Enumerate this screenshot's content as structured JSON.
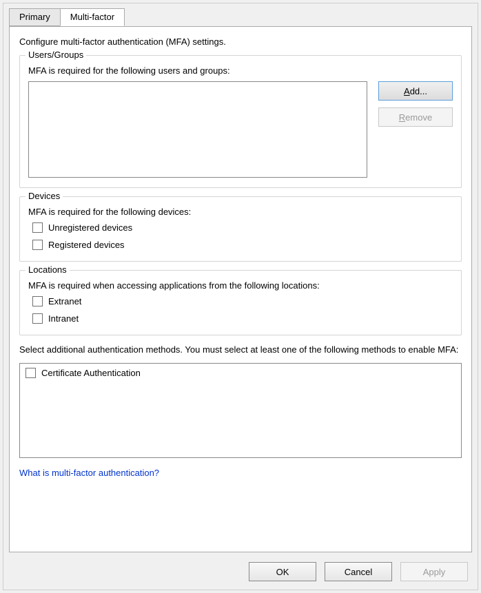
{
  "tabs": {
    "primary": "Primary",
    "multifactor": "Multi-factor"
  },
  "intro": "Configure multi-factor authentication (MFA) settings.",
  "users_groups": {
    "legend": "Users/Groups",
    "desc": "MFA is required for the following users and groups:",
    "add_prefix": "A",
    "add_rest": "dd...",
    "remove_prefix": "R",
    "remove_rest": "emove"
  },
  "devices": {
    "legend": "Devices",
    "desc": "MFA is required for the following devices:",
    "unregistered": "Unregistered devices",
    "registered": "Registered devices"
  },
  "locations": {
    "legend": "Locations",
    "desc": "MFA is required when accessing applications from the following locations:",
    "extranet": "Extranet",
    "intranet": "Intranet"
  },
  "additional": "Select additional authentication methods. You must select at least one of the following methods to enable MFA:",
  "methods": {
    "cert_auth": "Certificate Authentication"
  },
  "link": "What is multi-factor authentication?",
  "buttons": {
    "ok": "OK",
    "cancel": "Cancel",
    "apply": "Apply"
  }
}
